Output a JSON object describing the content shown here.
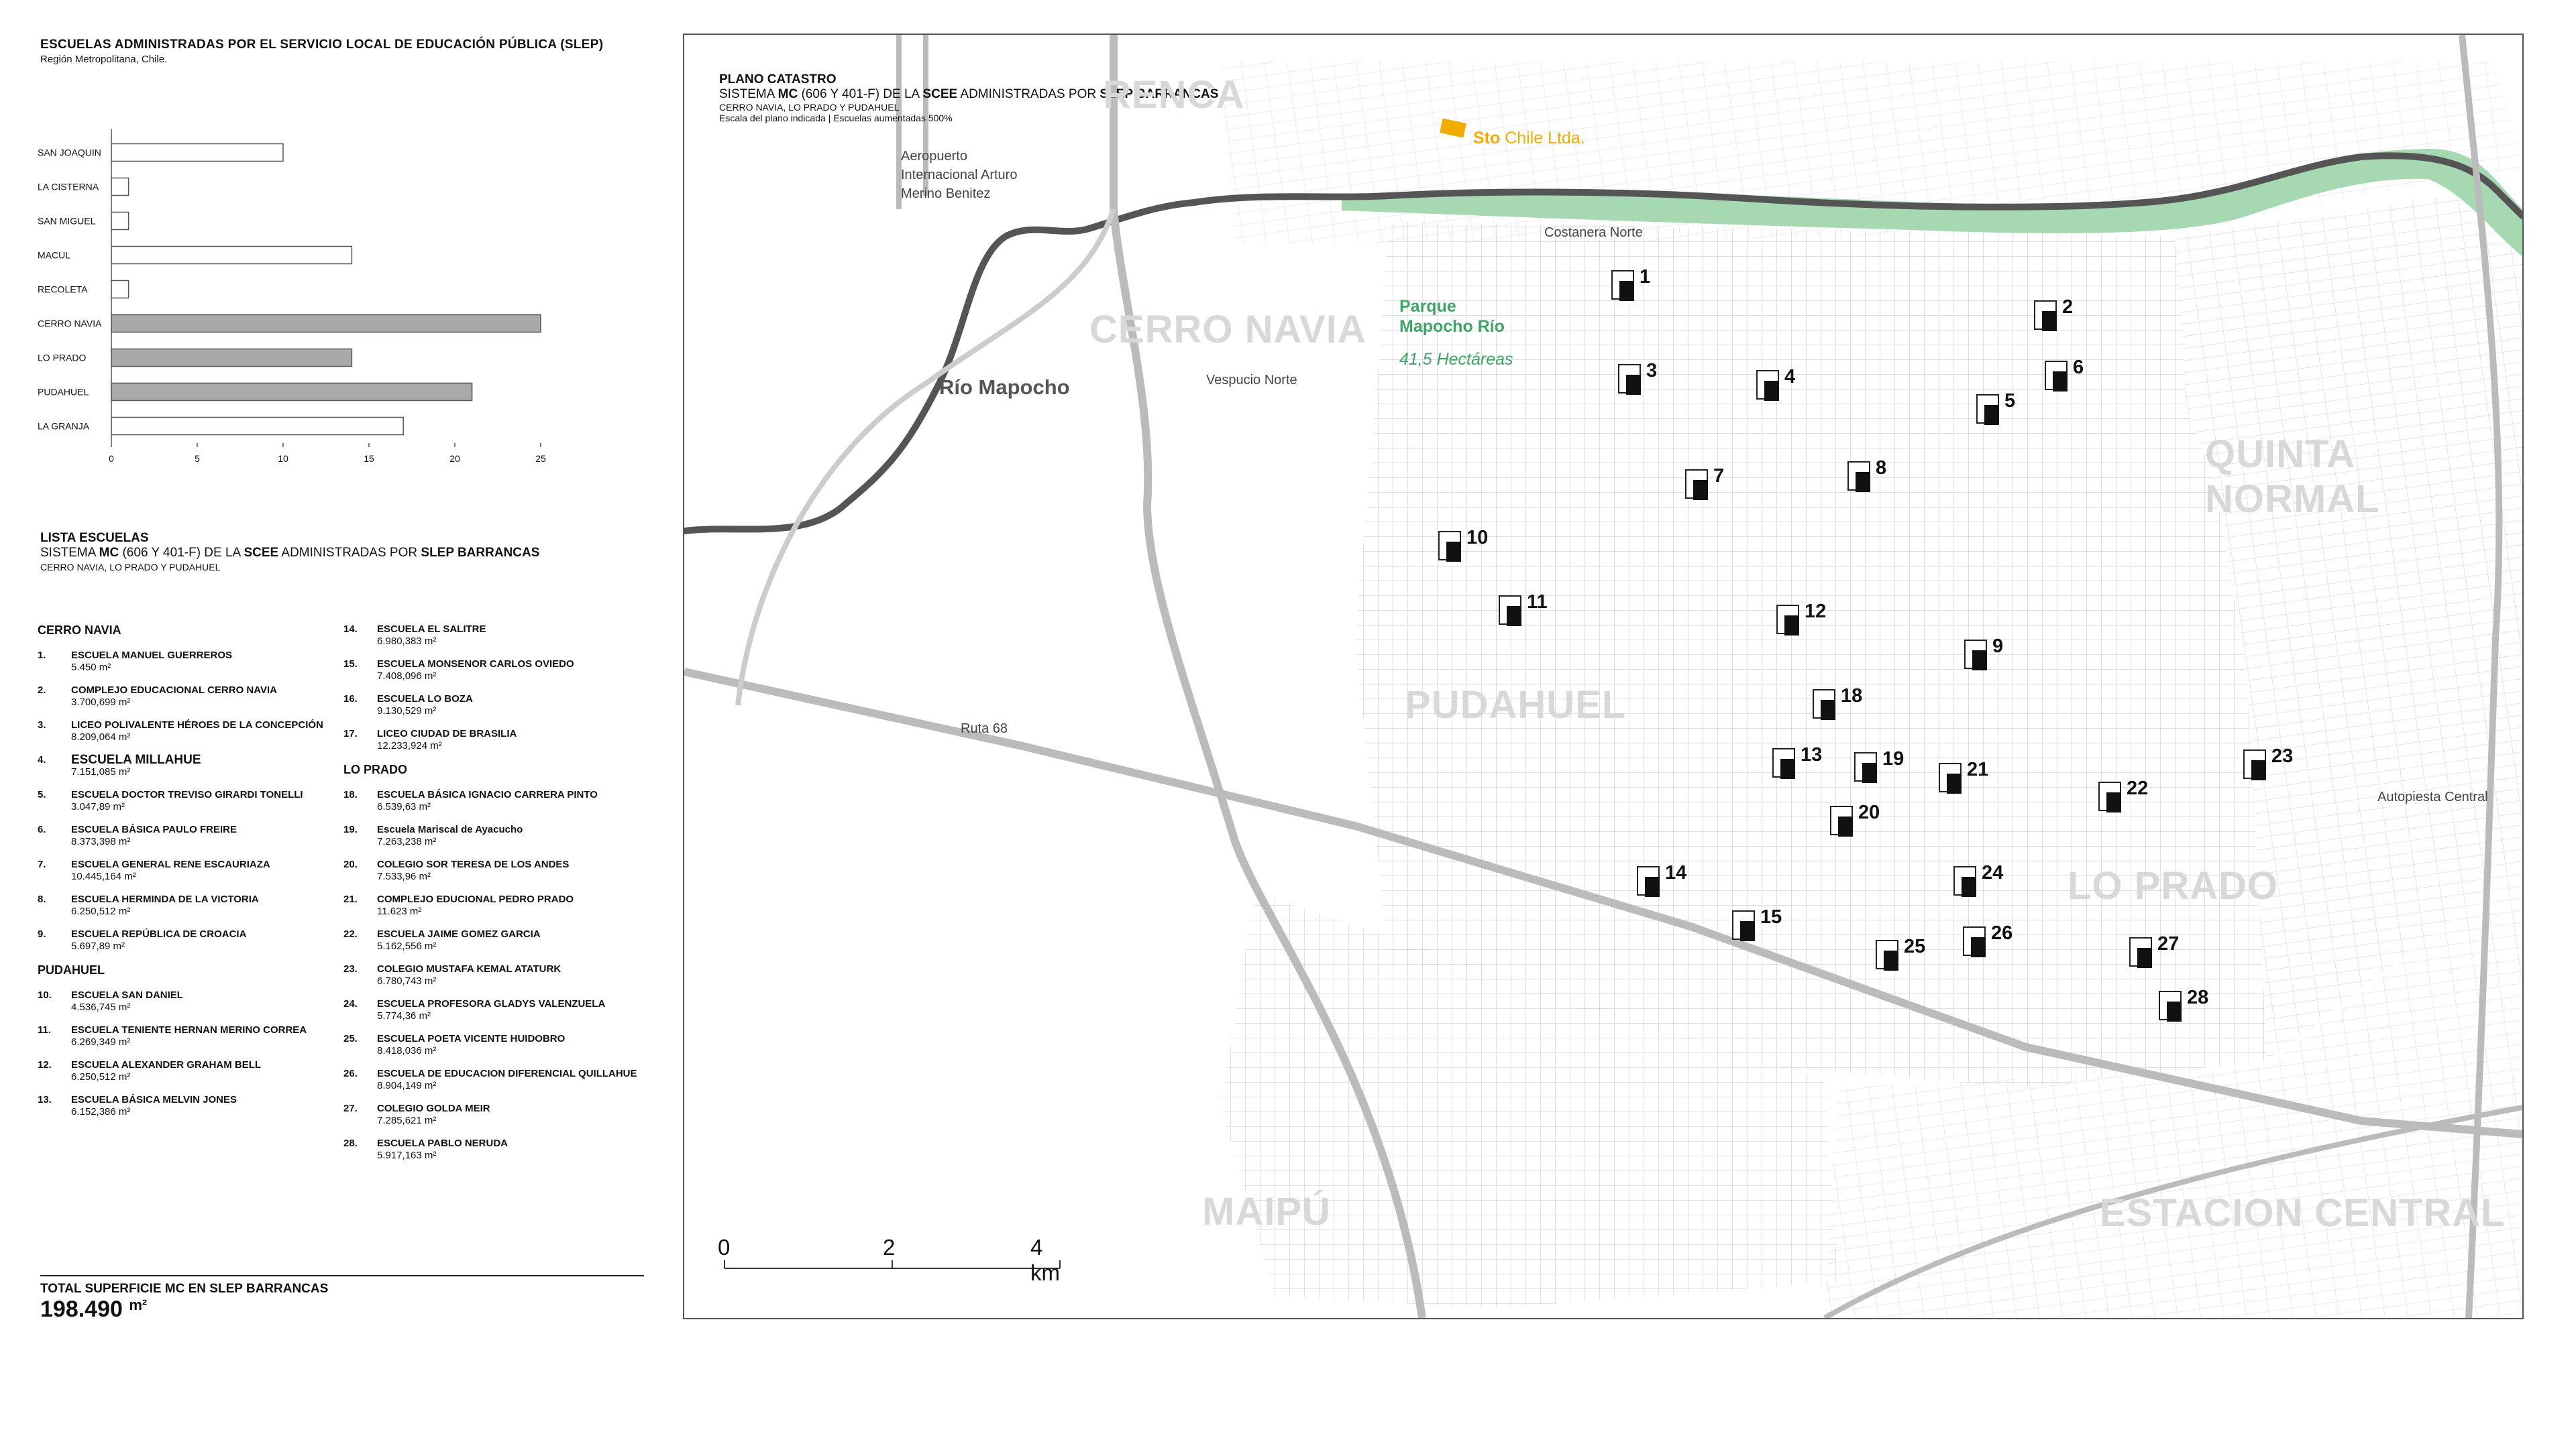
{
  "header": {
    "title": "ESCUELAS ADMINISTRADAS POR EL SERVICIO LOCAL DE EDUCACIÓN PÚBLICA (SLEP)",
    "subtitle": "Región Metropolitana, Chile."
  },
  "chart_data": {
    "type": "bar",
    "orientation": "horizontal",
    "categories": [
      "SAN JOAQUIN",
      "LA CISTERNA",
      "SAN MIGUEL",
      "MACUL",
      "RECOLETA",
      "CERRO NAVIA",
      "LO PRADO",
      "PUDAHUEL",
      "LA GRANJA"
    ],
    "values": [
      10,
      1,
      1,
      14,
      1,
      25,
      14,
      21,
      17
    ],
    "highlighted": [
      false,
      false,
      false,
      false,
      false,
      true,
      true,
      true,
      false
    ],
    "ticks": [
      "0",
      "5",
      "10",
      "15",
      "20",
      "25"
    ],
    "xlim": [
      0,
      25
    ],
    "colors": {
      "normal": "#ffffff",
      "highlight": "#a9a9a9",
      "stroke": "#555555"
    }
  },
  "list": {
    "title": "LISTA ESCUELAS",
    "subtitle_pre": "SISTEMA ",
    "subtitle_b1": "MC",
    "subtitle_mid": " (606 Y 401-F) DE LA ",
    "subtitle_b2": "SCEE",
    "subtitle_post": " ADMINISTRADAS POR ",
    "subtitle_b3": "SLEP BARRANCAS",
    "subtitle2": "CERRO NAVIA, LO PRADO Y PUDAHUEL",
    "sections": {
      "cerro_navia": "CERRO NAVIA",
      "pudahuel": "PUDAHUEL",
      "lo_prado": "LO PRADO"
    },
    "schools": [
      {
        "n": "1.",
        "name": "ESCUELA MANUEL GUERREROS",
        "area": "5.450 m²"
      },
      {
        "n": "2.",
        "name": "COMPLEJO EDUCACIONAL CERRO NAVIA",
        "area": "3.700,699 m²"
      },
      {
        "n": "3.",
        "name": "LICEO POLIVALENTE HÉROES DE LA CONCEPCIÓN",
        "area": "8.209,064 m²"
      },
      {
        "n": "4.",
        "name": "ESCUELA MILLAHUE",
        "area": "7.151,085 m²"
      },
      {
        "n": "5.",
        "name": "ESCUELA DOCTOR TREVISO GIRARDI TONELLI",
        "area": "3.047,89 m²"
      },
      {
        "n": "6.",
        "name": "ESCUELA BÁSICA PAULO FREIRE",
        "area": "8.373,398 m²"
      },
      {
        "n": "7.",
        "name": "ESCUELA GENERAL RENE ESCAURIAZA",
        "area": "10.445,164 m²"
      },
      {
        "n": "8.",
        "name": "ESCUELA HERMINDA DE LA VICTORIA",
        "area": "6.250,512 m²"
      },
      {
        "n": "9.",
        "name": "ESCUELA REPÚBLICA DE CROACIA",
        "area": "5.697,89 m²"
      },
      {
        "n": "10.",
        "name": "ESCUELA SAN DANIEL",
        "area": "4.536,745 m²"
      },
      {
        "n": "11.",
        "name": "ESCUELA TENIENTE HERNAN MERINO CORREA",
        "area": "6.269,349 m²"
      },
      {
        "n": "12.",
        "name": "ESCUELA ALEXANDER GRAHAM BELL",
        "area": "6.250,512 m²"
      },
      {
        "n": "13.",
        "name": "ESCUELA BÁSICA MELVIN JONES",
        "area": "6.152,386 m²"
      },
      {
        "n": "14.",
        "name": "ESCUELA EL SALITRE",
        "area": "6.980,383 m²"
      },
      {
        "n": "15.",
        "name": "ESCUELA MONSENOR CARLOS OVIEDO",
        "area": "7.408,096 m²"
      },
      {
        "n": "16.",
        "name": "ESCUELA LO BOZA",
        "area": "9.130,529 m²"
      },
      {
        "n": "17.",
        "name": "LICEO CIUDAD DE BRASILIA",
        "area": "12.233,924 m²"
      },
      {
        "n": "18.",
        "name": "ESCUELA BÁSICA IGNACIO CARRERA PINTO",
        "area": "6.539,63 m²"
      },
      {
        "n": "19.",
        "name": "Escuela Mariscal de Ayacucho",
        "area": "7.263,238 m²"
      },
      {
        "n": "20.",
        "name": "COLEGIO SOR TERESA DE LOS ANDES",
        "area": "7.533,96 m²"
      },
      {
        "n": "21.",
        "name": "COMPLEJO EDUCIONAL PEDRO PRADO",
        "area": "11.623 m²"
      },
      {
        "n": "22.",
        "name": "ESCUELA JAIME GOMEZ GARCIA",
        "area": "5.162,556 m²"
      },
      {
        "n": "23.",
        "name": "COLEGIO MUSTAFA KEMAL ATATURK",
        "area": "6.780,743 m²"
      },
      {
        "n": "24.",
        "name": "ESCUELA PROFESORA GLADYS VALENZUELA",
        "area": "5.774,36 m²"
      },
      {
        "n": "25.",
        "name": "ESCUELA POETA VICENTE HUIDOBRO",
        "area": "8.418,036 m²"
      },
      {
        "n": "26.",
        "name": "ESCUELA DE EDUCACION DIFERENCIAL QUILLAHUE",
        "area": "8.904,149 m²"
      },
      {
        "n": "27.",
        "name": "COLEGIO GOLDA MEIR",
        "area": "7.285,621 m²"
      },
      {
        "n": "28.",
        "name": "ESCUELA PABLO NERUDA",
        "area": "5.917,163 m²"
      }
    ]
  },
  "total": {
    "label_l1": "TOTAL SUPERFICIE MC EN SLEP BARRANCAS",
    "value": "198.490",
    "unit": "m²"
  },
  "map": {
    "title": "PLANO CATASTRO",
    "sub_pre": "SISTEMA ",
    "sub_b1": "MC",
    "sub_mid": " (606 Y 401-F) DE LA ",
    "sub_b2": "SCEE",
    "sub_post": " ADMINISTRADAS POR ",
    "sub_b3": "SLEP BARRANCAS",
    "sub2": "CERRO NAVIA, LO PRADO Y PUDAHUEL",
    "sub3": "Escala del plano indicada | Escuelas aumentadas 500%",
    "communes": {
      "renca": "RENCA",
      "cerro_navia": "CERRO NAVIA",
      "quinta_normal": "QUINTA NORMAL",
      "pudahuel": "PUDAHUEL",
      "lo_prado": "LO PRADO",
      "maipu": "MAIPÚ",
      "estacion_central": "ESTACION CENTRAL"
    },
    "labels": {
      "aeropuerto_1": "Aeropuerto",
      "aeropuerto_2": "Internacional Arturo",
      "aeropuerto_3": "Merino Benitez",
      "costanera": "Costanera Norte",
      "vespucio": "Vespucio Norte",
      "rio": "Río Mapocho",
      "ruta68": "Ruta 68",
      "autopista": "Autopiesta Central",
      "park_1": "Parque",
      "park_2": "Mapocho Río",
      "park_ha": "41,5 Hectáreas",
      "sto_b": "Sto",
      "sto_rest": " Chile Ltda."
    },
    "scale": {
      "s0": "0",
      "s2": "2",
      "s4": "4 km"
    },
    "pins": [
      "1",
      "2",
      "3",
      "4",
      "5",
      "6",
      "7",
      "8",
      "9",
      "10",
      "11",
      "12",
      "13",
      "14",
      "15",
      "18",
      "19",
      "20",
      "21",
      "22",
      "23",
      "24",
      "25",
      "26",
      "27",
      "28"
    ],
    "colors": {
      "park": "#a6d8b2",
      "river": "#555555",
      "road": "#bbbbbb",
      "sto": "#f0ad00"
    }
  }
}
